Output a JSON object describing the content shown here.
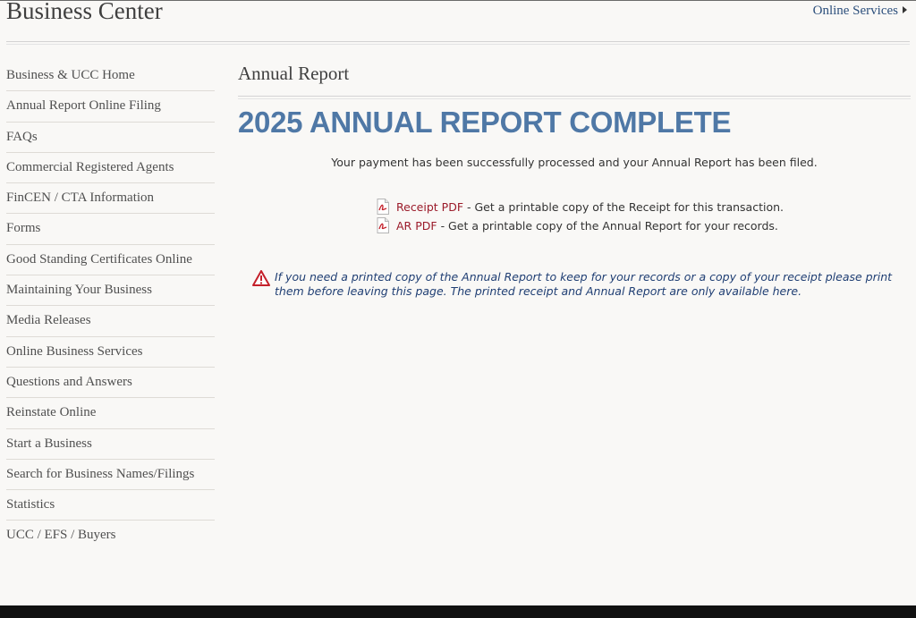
{
  "header": {
    "title": "Business Center",
    "online_services": "Online Services"
  },
  "sidebar": {
    "items": [
      {
        "label": "Business & UCC Home"
      },
      {
        "label": "Annual Report Online Filing"
      },
      {
        "label": "FAQs"
      },
      {
        "label": "Commercial Registered Agents"
      },
      {
        "label": "FinCEN / CTA Information"
      },
      {
        "label": "Forms"
      },
      {
        "label": "Good Standing Certificates Online"
      },
      {
        "label": "Maintaining Your Business"
      },
      {
        "label": "Media Releases"
      },
      {
        "label": "Online Business Services"
      },
      {
        "label": "Questions and Answers"
      },
      {
        "label": "Reinstate Online"
      },
      {
        "label": "Start a Business"
      },
      {
        "label": "Search for Business Names/Filings"
      },
      {
        "label": "Statistics"
      },
      {
        "label": "UCC / EFS / Buyers"
      }
    ]
  },
  "main": {
    "heading": "Annual Report",
    "complete_title": "2025 ANNUAL REPORT COMPLETE",
    "success_message": "Your payment has been successfully processed and your Annual Report has been filed.",
    "receipt": {
      "link": "Receipt PDF",
      "description": "- Get a printable copy of the Receipt for this transaction."
    },
    "ar": {
      "link": "AR PDF",
      "description": "- Get a printable copy of the Annual Report for your records."
    },
    "notice": "If you need a printed copy of the Annual Report to keep for your records or a copy of your receipt please print them before leaving this page. The printed receipt and Annual Report are only available here."
  },
  "icons": {
    "pdf": "pdf-file-icon",
    "warning": "warning-triangle-icon",
    "arrow": "arrow-right-icon"
  },
  "colors": {
    "title_blue": "#4f78a6",
    "link_red": "#9b1b2a",
    "notice_blue": "#1f3e73",
    "nav_blue": "#2c4f7c"
  }
}
